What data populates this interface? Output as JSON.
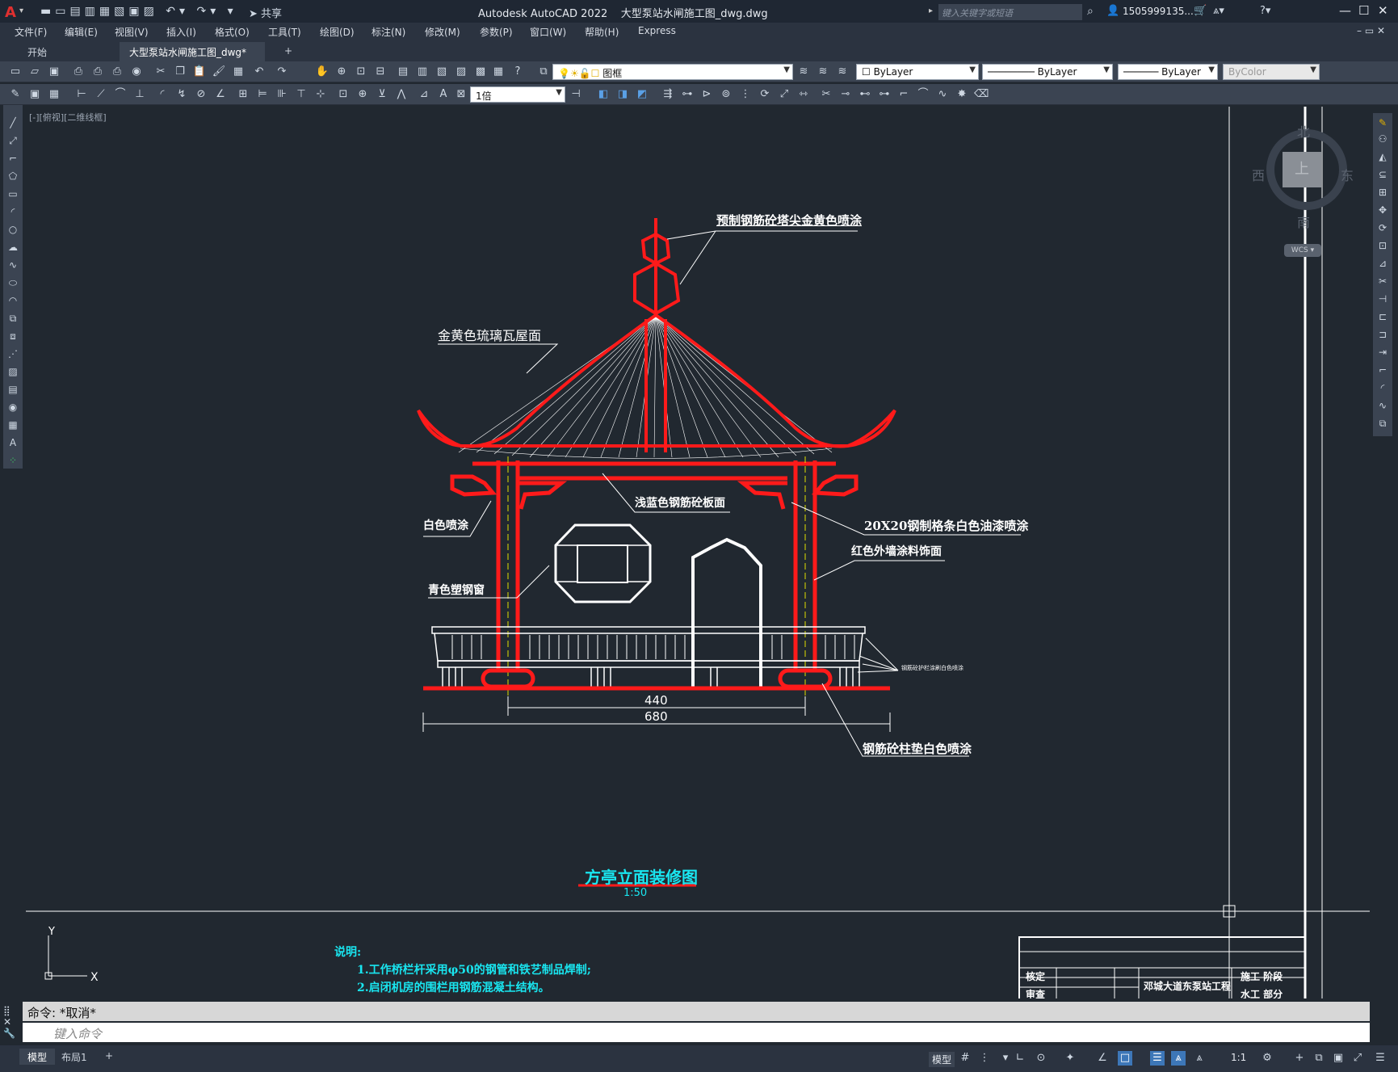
{
  "app": {
    "title": "Autodesk AutoCAD 2022",
    "filename": "大型泵站水闸施工图_dwg.dwg",
    "search_placeholder": "键入关键字或短语",
    "user": "1505999135...",
    "share": "共享"
  },
  "menu": [
    "文件(F)",
    "编辑(E)",
    "视图(V)",
    "插入(I)",
    "格式(O)",
    "工具(T)",
    "绘图(D)",
    "标注(N)",
    "修改(M)",
    "参数(P)",
    "窗口(W)",
    "帮助(H)",
    "Express"
  ],
  "tabs": {
    "start": "开始",
    "active": "大型泵站水闸施工图_dwg*",
    "close": "×",
    "add": "+"
  },
  "toolbar": {
    "layer": "图框",
    "color": "ByLayer",
    "linetype": "ByLayer",
    "lineweight": "ByLayer",
    "plotstyle": "ByColor",
    "scale": "1倍"
  },
  "viewport": {
    "label": "[-][俯视][二维线框]"
  },
  "viewcube": {
    "north": "北",
    "south": "南",
    "east": "东",
    "west": "西",
    "top": "上",
    "wcs": "WCS"
  },
  "drawing": {
    "callouts": {
      "spire": "预制钢筋砼塔尖金黄色喷涂",
      "roof": "金黄色琉璃瓦屋面",
      "ceiling": "浅蓝色钢筋砼板面",
      "white": "白色喷涂",
      "grille": "20X20钢制格条白色油漆喷涂",
      "redwall": "红色外墙涂料饰面",
      "window": "青色塑钢窗",
      "railing": "钢筋砼护栏涂刷白色喷涂",
      "base": "钢筋砼柱垫白色喷涂"
    },
    "dim_inner": "440",
    "dim_outer": "680",
    "title": "方亭立面装修图",
    "scale": "1:50",
    "ucs_x": "X",
    "ucs_y": "Y"
  },
  "notes": {
    "heading": "说明:",
    "line1": "1.工作桥栏杆采用φ50的钢管和铁艺制品焊制;",
    "line2": "2.启闭机房的围栏用钢筋混凝土结构。"
  },
  "titleblock": {
    "r1c1": "核定",
    "r2c1": "审查",
    "project": "邓城大道东泵站工程",
    "r1c3": "施工  阶段",
    "r2c3": "水工  部分"
  },
  "command": {
    "history": "命令: *取消*",
    "placeholder": "键入命令"
  },
  "status": {
    "model": "模型",
    "layout1": "布局1",
    "add": "+",
    "model_btn": "模型",
    "scale": "1:1"
  },
  "colors": {
    "red": "#ff1a1a",
    "cyan": "#19e6f0",
    "white": "#ffffff",
    "bg": "#212830",
    "blue": "#3d77b8"
  }
}
